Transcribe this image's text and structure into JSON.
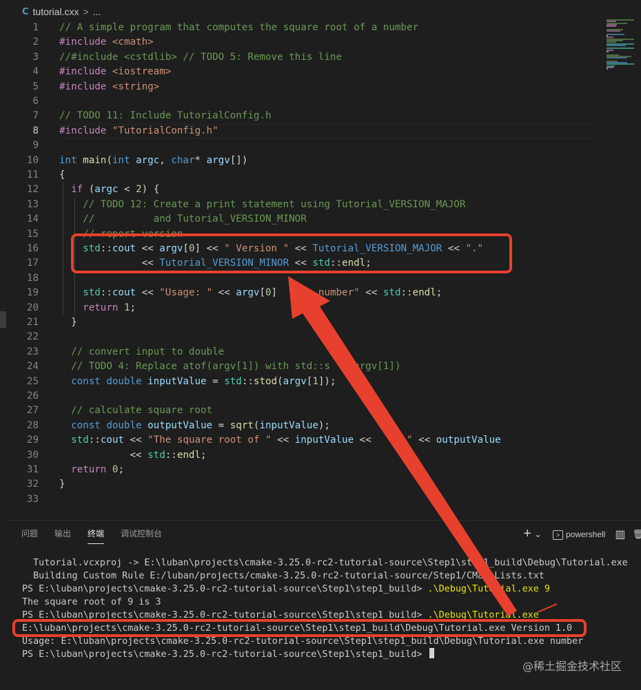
{
  "breadcrumb": {
    "file": "tutorial.cxx",
    "sep": ">",
    "more": "..."
  },
  "editor": {
    "current_line": 8,
    "lines": [
      {
        "n": "1",
        "t": [
          [
            "c-com",
            "// A simple program that computes the square root of a number"
          ]
        ]
      },
      {
        "n": "2",
        "t": [
          [
            "c-pp",
            "#include "
          ],
          [
            "c-inc",
            "<cmath>"
          ]
        ]
      },
      {
        "n": "3",
        "t": [
          [
            "c-com",
            "//#include <cstdlib> // TODO 5: Remove this line"
          ]
        ]
      },
      {
        "n": "4",
        "t": [
          [
            "c-pp",
            "#include "
          ],
          [
            "c-inc",
            "<iostream>"
          ]
        ]
      },
      {
        "n": "5",
        "t": [
          [
            "c-pp",
            "#include "
          ],
          [
            "c-inc",
            "<string>"
          ]
        ]
      },
      {
        "n": "6",
        "t": []
      },
      {
        "n": "7",
        "t": [
          [
            "c-com",
            "// TODO 11: Include TutorialConfig.h"
          ]
        ]
      },
      {
        "n": "8",
        "t": [
          [
            "c-pp",
            "#include "
          ],
          [
            "c-inc",
            "\"TutorialConfig.h\""
          ]
        ]
      },
      {
        "n": "9",
        "t": []
      },
      {
        "n": "10",
        "t": [
          [
            "c-kw",
            "int "
          ],
          [
            "c-fn",
            "main"
          ],
          [
            "c-txt",
            "("
          ],
          [
            "c-kw",
            "int "
          ],
          [
            "c-var",
            "argc"
          ],
          [
            "c-txt",
            ", "
          ],
          [
            "c-kw",
            "char"
          ],
          [
            "c-txt",
            "* "
          ],
          [
            "c-var",
            "argv"
          ],
          [
            "c-txt",
            "[])"
          ]
        ]
      },
      {
        "n": "11",
        "t": [
          [
            "c-txt",
            "{"
          ]
        ]
      },
      {
        "n": "12",
        "t": [
          [
            "c-txt",
            "  "
          ],
          [
            "c-pp",
            "if "
          ],
          [
            "c-txt",
            "("
          ],
          [
            "c-var",
            "argc"
          ],
          [
            "c-txt",
            " < "
          ],
          [
            "c-num",
            "2"
          ],
          [
            "c-txt",
            ") {"
          ]
        ]
      },
      {
        "n": "13",
        "t": [
          [
            "c-txt",
            "    "
          ],
          [
            "c-com",
            "// TODO 12: Create a print statement using Tutorial_VERSION_MAJOR"
          ]
        ]
      },
      {
        "n": "14",
        "t": [
          [
            "c-txt",
            "    "
          ],
          [
            "c-com",
            "//          and Tutorial_VERSION_MINOR"
          ]
        ]
      },
      {
        "n": "15",
        "t": [
          [
            "c-txt",
            "    "
          ],
          [
            "c-com",
            "// report version"
          ]
        ]
      },
      {
        "n": "16",
        "t": [
          [
            "c-txt",
            "    "
          ],
          [
            "c-ns",
            "std"
          ],
          [
            "c-txt",
            "::"
          ],
          [
            "c-var",
            "cout"
          ],
          [
            "c-txt",
            " << "
          ],
          [
            "c-var",
            "argv"
          ],
          [
            "c-txt",
            "["
          ],
          [
            "c-num",
            "0"
          ],
          [
            "c-txt",
            "] << "
          ],
          [
            "c-str",
            "\" Version \""
          ],
          [
            "c-txt",
            " << "
          ],
          [
            "c-mac",
            "Tutorial_VERSION_MAJOR"
          ],
          [
            "c-txt",
            " << "
          ],
          [
            "c-str",
            "\".\""
          ]
        ]
      },
      {
        "n": "17",
        "t": [
          [
            "c-txt",
            "              << "
          ],
          [
            "c-mac",
            "Tutorial_VERSION_MINOR"
          ],
          [
            "c-txt",
            " << "
          ],
          [
            "c-ns",
            "std"
          ],
          [
            "c-txt",
            "::"
          ],
          [
            "c-fn",
            "endl"
          ],
          [
            "c-txt",
            ";"
          ]
        ]
      },
      {
        "n": "18",
        "t": []
      },
      {
        "n": "19",
        "t": [
          [
            "c-txt",
            "    "
          ],
          [
            "c-ns",
            "std"
          ],
          [
            "c-txt",
            "::"
          ],
          [
            "c-var",
            "cout"
          ],
          [
            "c-txt",
            " << "
          ],
          [
            "c-str",
            "\"Usage: \""
          ],
          [
            "c-txt",
            " << "
          ],
          [
            "c-var",
            "argv"
          ],
          [
            "c-txt",
            "["
          ],
          [
            "c-num",
            "0"
          ],
          [
            "c-txt",
            "]       "
          ],
          [
            "c-str",
            "number\""
          ],
          [
            "c-txt",
            " << "
          ],
          [
            "c-ns",
            "std"
          ],
          [
            "c-txt",
            "::"
          ],
          [
            "c-fn",
            "endl"
          ],
          [
            "c-txt",
            ";"
          ]
        ]
      },
      {
        "n": "20",
        "t": [
          [
            "c-txt",
            "    "
          ],
          [
            "c-pp",
            "return "
          ],
          [
            "c-num",
            "1"
          ],
          [
            "c-txt",
            ";"
          ]
        ]
      },
      {
        "n": "21",
        "t": [
          [
            "c-txt",
            "  }"
          ]
        ]
      },
      {
        "n": "22",
        "t": []
      },
      {
        "n": "23",
        "t": [
          [
            "c-txt",
            "  "
          ],
          [
            "c-com",
            "// convert input to double"
          ]
        ]
      },
      {
        "n": "24",
        "t": [
          [
            "c-txt",
            "  "
          ],
          [
            "c-com",
            "// TODO 4: Replace atof(argv[1]) with std::s   (argv[1])"
          ]
        ]
      },
      {
        "n": "25",
        "t": [
          [
            "c-txt",
            "  "
          ],
          [
            "c-kw",
            "const double "
          ],
          [
            "c-var",
            "inputValue"
          ],
          [
            "c-txt",
            " = "
          ],
          [
            "c-ns",
            "std"
          ],
          [
            "c-txt",
            "::"
          ],
          [
            "c-fn",
            "stod"
          ],
          [
            "c-txt",
            "("
          ],
          [
            "c-var",
            "argv"
          ],
          [
            "c-txt",
            "["
          ],
          [
            "c-num",
            "1"
          ],
          [
            "c-txt",
            "]);"
          ]
        ]
      },
      {
        "n": "26",
        "t": []
      },
      {
        "n": "27",
        "t": [
          [
            "c-txt",
            "  "
          ],
          [
            "c-com",
            "// calculate square root"
          ]
        ]
      },
      {
        "n": "28",
        "t": [
          [
            "c-txt",
            "  "
          ],
          [
            "c-kw",
            "const double "
          ],
          [
            "c-var",
            "outputValue"
          ],
          [
            "c-txt",
            " = "
          ],
          [
            "c-fn",
            "sqrt"
          ],
          [
            "c-txt",
            "("
          ],
          [
            "c-var",
            "inputValue"
          ],
          [
            "c-txt",
            ");"
          ]
        ]
      },
      {
        "n": "29",
        "t": [
          [
            "c-txt",
            "  "
          ],
          [
            "c-ns",
            "std"
          ],
          [
            "c-txt",
            "::"
          ],
          [
            "c-var",
            "cout"
          ],
          [
            "c-txt",
            " << "
          ],
          [
            "c-str",
            "\"The square root of \""
          ],
          [
            "c-txt",
            " << "
          ],
          [
            "c-var",
            "inputValue"
          ],
          [
            "c-txt",
            " <<    "
          ],
          [
            "c-str",
            "s \""
          ],
          [
            "c-txt",
            " << "
          ],
          [
            "c-var",
            "outputValue"
          ]
        ]
      },
      {
        "n": "30",
        "t": [
          [
            "c-txt",
            "            << "
          ],
          [
            "c-ns",
            "std"
          ],
          [
            "c-txt",
            "::"
          ],
          [
            "c-fn",
            "endl"
          ],
          [
            "c-txt",
            ";"
          ]
        ]
      },
      {
        "n": "31",
        "t": [
          [
            "c-txt",
            "  "
          ],
          [
            "c-pp",
            "return "
          ],
          [
            "c-num",
            "0"
          ],
          [
            "c-txt",
            ";"
          ]
        ]
      },
      {
        "n": "32",
        "t": [
          [
            "c-txt",
            "}"
          ]
        ]
      },
      {
        "n": "33",
        "t": []
      }
    ]
  },
  "panel": {
    "tabs": [
      "问题",
      "输出",
      "终端",
      "调试控制台"
    ],
    "active_tab": "终端",
    "add_label": "+",
    "dropdown": "⌄",
    "shell_label": "powershell",
    "shell_icon_text": ">",
    "split_icon": "▥",
    "trash_icon": "🗑"
  },
  "terminal": {
    "lines": [
      {
        "indent": "  ",
        "text": "Tutorial.vcxproj -> E:\\luban\\projects\\cmake-3.25.0-rc2-tutorial-source\\Step1\\step1_build\\Debug\\Tutorial.exe",
        "hl": ""
      },
      {
        "indent": "  ",
        "text": "Building Custom Rule E:/luban/projects/cmake-3.25.0-rc2-tutorial-source/Step1/CMakeLists.txt",
        "hl": ""
      },
      {
        "indent": "",
        "text": "PS E:\\luban\\projects\\cmake-3.25.0-rc2-tutorial-source\\Step1\\step1_build> ",
        "hl": ".\\Debug\\Tutorial.exe 9"
      },
      {
        "indent": "",
        "text": "The square root of 9 is 3",
        "hl": ""
      },
      {
        "indent": "",
        "text": "PS E:\\luban\\projects\\cmake-3.25.0-rc2-tutorial-source\\Step1\\step1_build> ",
        "hl": ".\\Debug\\Tutorial.exe"
      },
      {
        "indent": "",
        "text": "E:\\luban\\projects\\cmake-3.25.0-rc2-tutorial-source\\Step1\\step1_build\\Debug\\Tutorial.exe Version 1.0",
        "hl": ""
      },
      {
        "indent": "",
        "text": "Usage: E:\\luban\\projects\\cmake-3.25.0-rc2-tutorial-source\\Step1\\step1_build\\Debug\\Tutorial.exe number",
        "hl": ""
      },
      {
        "indent": "",
        "text": "PS E:\\luban\\projects\\cmake-3.25.0-rc2-tutorial-source\\Step1\\step1_build> ",
        "hl": ""
      }
    ]
  },
  "watermark": "@稀土掘金技术社区",
  "colors": {
    "annotation": "#e8402e",
    "background": "#1e1e1e"
  }
}
